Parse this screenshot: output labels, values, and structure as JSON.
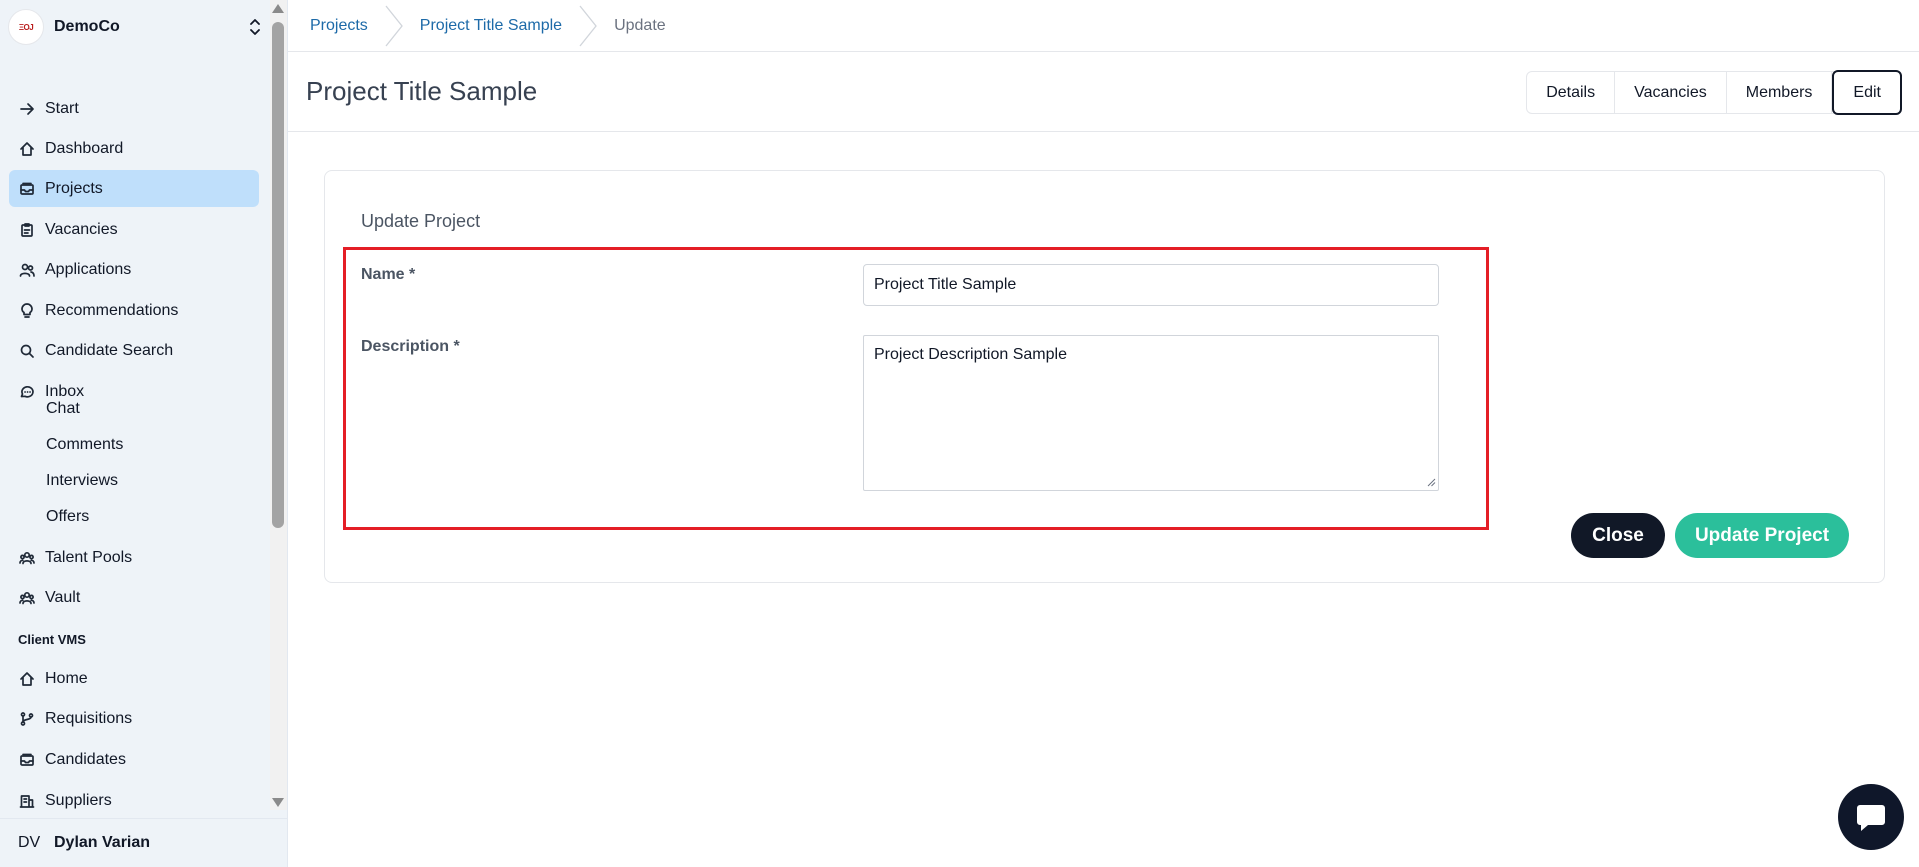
{
  "org": {
    "name": "DemoCo",
    "logo_text": "ΞOJ"
  },
  "sidebar": {
    "items": [
      {
        "label": "Start",
        "icon": "arrow-right-icon"
      },
      {
        "label": "Dashboard",
        "icon": "home-icon"
      },
      {
        "label": "Projects",
        "icon": "inbox-stack-icon",
        "active": true
      },
      {
        "label": "Vacancies",
        "icon": "clipboard-icon"
      },
      {
        "label": "Applications",
        "icon": "users-icon"
      },
      {
        "label": "Recommendations",
        "icon": "lightbulb-icon"
      },
      {
        "label": "Candidate Search",
        "icon": "search-icon"
      },
      {
        "label": "Inbox",
        "icon": "chat-bubble-icon"
      }
    ],
    "inbox_sub": [
      "Chat",
      "Comments",
      "Interviews",
      "Offers"
    ],
    "items2": [
      {
        "label": "Talent Pools",
        "icon": "user-group-icon"
      },
      {
        "label": "Vault",
        "icon": "user-group-icon"
      }
    ],
    "section_label": "Client VMS",
    "items3": [
      {
        "label": "Home",
        "icon": "home-icon"
      },
      {
        "label": "Requisitions",
        "icon": "branch-icon"
      },
      {
        "label": "Candidates",
        "icon": "inbox-stack-icon"
      },
      {
        "label": "Suppliers",
        "icon": "building-icon"
      }
    ]
  },
  "user": {
    "initials": "DV",
    "name": "Dylan Varian"
  },
  "breadcrumb": [
    "Projects",
    "Project Title Sample",
    "Update"
  ],
  "page": {
    "title": "Project Title Sample",
    "tabs": [
      "Details",
      "Vacancies",
      "Members",
      "Edit"
    ],
    "active_tab": "Edit"
  },
  "form": {
    "title": "Update Project",
    "name_label": "Name *",
    "name_value": "Project Title Sample",
    "description_label": "Description *",
    "description_value": "Project Description Sample",
    "close_label": "Close",
    "submit_label": "Update Project"
  },
  "colors": {
    "sidebar_bg": "#eef3f8",
    "active_item": "#bfdffb",
    "link": "#1d6aa8",
    "primary_button": "#2bbf9b",
    "dark_button": "#111827",
    "highlight": "#e41e26"
  }
}
